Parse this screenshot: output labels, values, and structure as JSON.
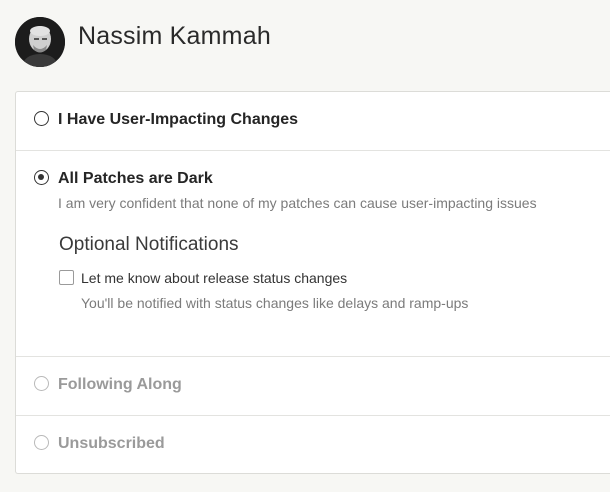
{
  "header": {
    "name": "Nassim Kammah"
  },
  "options": [
    {
      "label": "I Have User-Impacting Changes",
      "selected": false
    },
    {
      "label": "All Patches are Dark",
      "selected": true,
      "description": "I am very confident that none of my patches can cause user-impacting issues",
      "optional_notifications": {
        "title": "Optional Notifications",
        "checkbox_label": "Let me know about release status changes",
        "checkbox_checked": false,
        "checkbox_description": "You'll be notified with status changes like delays and ramp-ups"
      }
    },
    {
      "label": "Following Along",
      "selected": false
    },
    {
      "label": "Unsubscribed",
      "selected": false
    }
  ]
}
